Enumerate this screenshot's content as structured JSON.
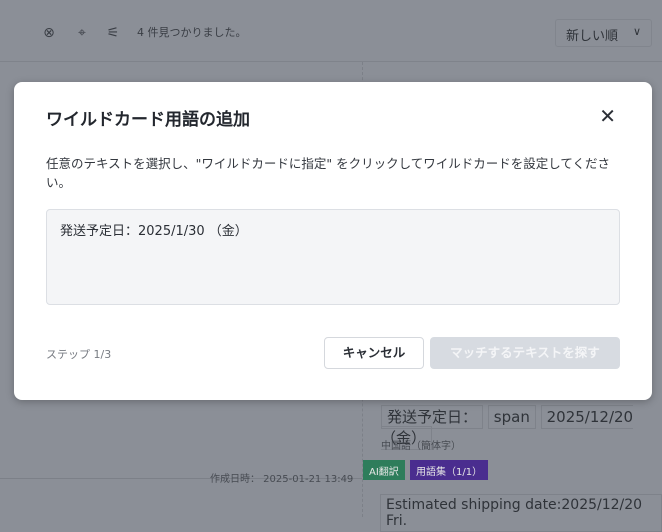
{
  "toolbar": {
    "found_text": "4 件見つかりました。",
    "sort_label": "新しい順",
    "icons": [
      "clear-circle-icon",
      "target-icon",
      "filter-settings-icon",
      "chevron-down-icon"
    ]
  },
  "background": {
    "source_label": "発送予定日：",
    "span_tag": "span",
    "date_value": "2025/12/20 （金）",
    "language_label": "中国語（簡体字）",
    "created_at": "作成日時： 2025-01-21 13:49",
    "badge_ai": "AI翻訳",
    "badge_glossary": "用語集（1/1）",
    "translation": "Estimated shipping date:2025/12/20 Fri.",
    "colors": {
      "ai_badge": "#2e7d5b",
      "glossary_badge": "#4a2d8f"
    }
  },
  "modal": {
    "title": "ワイルドカード用語の追加",
    "description": "任意のテキストを選択し、\"ワイルドカードに指定\" をクリックしてワイルドカードを設定してください。",
    "source_text": "発送予定日：2025/1/30 （金）",
    "step": "ステップ 1/3",
    "cancel_label": "キャンセル",
    "find_label": "マッチするテキストを探す"
  }
}
